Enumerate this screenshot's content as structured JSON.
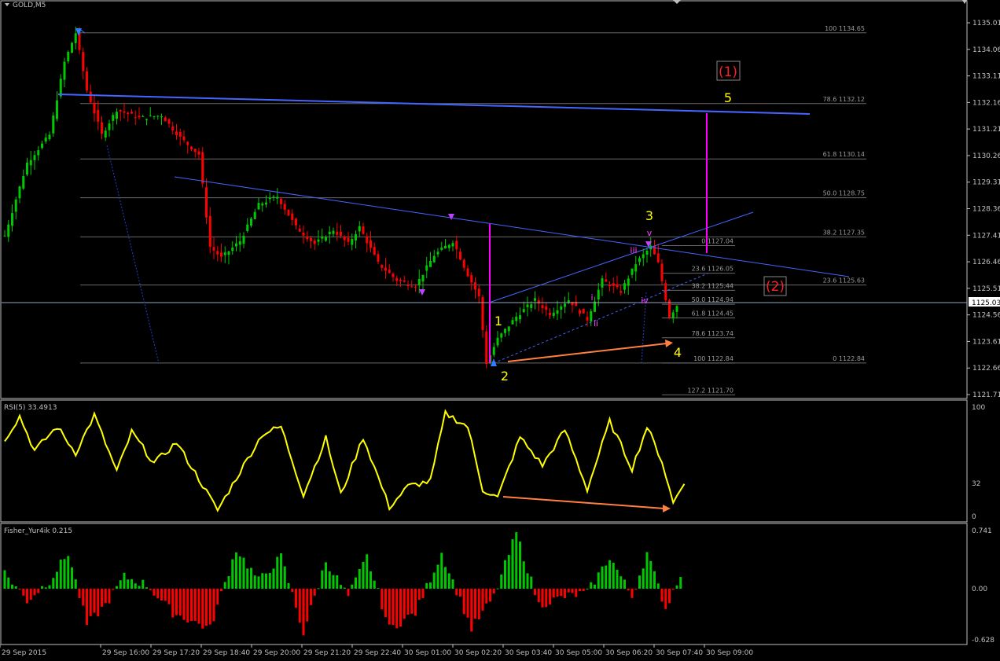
{
  "symbol": "GOLD,M5",
  "colors": {
    "background": "#000000",
    "frame": "#c0c0c0",
    "grid_text": "#c0c0c0",
    "bull": "#00c800",
    "bear": "#ff0000",
    "trend": "#4060ff",
    "fib": "#808080",
    "rsi": "#ffff00",
    "wave_yellow": "#ffff00",
    "wave_magenta": "#ff00ff",
    "wave_red": "#ff0000",
    "arrow_orange": "#ff8040",
    "marker_blue": "#2f7fff"
  },
  "price_axis": {
    "ticks": [
      "1135.01",
      "1134.06",
      "1133.11",
      "1132.16",
      "1131.21",
      "1130.26",
      "1129.31",
      "1128.36",
      "1127.41",
      "1126.46",
      "1125.51",
      "1124.56",
      "1123.61",
      "1122.66",
      "1121.71"
    ],
    "current": "1125.03"
  },
  "fib_levels": [
    {
      "label": "100 1134.65",
      "price": 1134.65
    },
    {
      "label": "78.6 1132.12",
      "price": 1132.12
    },
    {
      "label": "61.8 1130.14",
      "price": 1130.14
    },
    {
      "label": "50.0 1128.75",
      "price": 1128.75
    },
    {
      "label": "38.2 1127.35",
      "price": 1127.35
    },
    {
      "label": "23.6 1125.63",
      "price": 1125.63
    },
    {
      "label": "0 1122.84",
      "price": 1122.84
    }
  ],
  "fib2_levels": [
    {
      "label": "0 1127.04",
      "price": 1127.04
    },
    {
      "label": "23.6 1126.05",
      "price": 1126.05
    },
    {
      "label": "38.2 1125.44",
      "price": 1125.44
    },
    {
      "label": "50.0 1124.94",
      "price": 1124.94
    },
    {
      "label": "61.8 1124.45",
      "price": 1124.45
    },
    {
      "label": "78.6 1123.74",
      "price": 1123.74
    },
    {
      "label": "100 1122.84",
      "price": 1122.84
    },
    {
      "label": "127.2 1121.70",
      "price": 1121.7
    }
  ],
  "wave_labels": {
    "big1": "(1)",
    "big2": "(2)",
    "w1": "1",
    "w2": "2",
    "w3": "3",
    "w4": "4",
    "w5": "5",
    "si": "i",
    "sii": "ii",
    "siii": "iii",
    "siv": "iv",
    "sv": "v"
  },
  "rsi": {
    "label": "RSI(5) 33.4913",
    "scale": [
      "100",
      "32",
      "0"
    ]
  },
  "fisher": {
    "label": "Fisher_Yur4ik 0.215",
    "scale": [
      "0.741",
      "0.00",
      "-0.628"
    ]
  },
  "time_labels": [
    "29 Sep 2015",
    "29 Sep 16:00",
    "29 Sep 17:20",
    "29 Sep 18:40",
    "29 Sep 20:00",
    "29 Sep 21:20",
    "29 Sep 22:40",
    "30 Sep 01:00",
    "30 Sep 02:20",
    "30 Sep 03:40",
    "30 Sep 05:00",
    "30 Sep 06:20",
    "30 Sep 07:40",
    "30 Sep 09:00"
  ],
  "chart_data": {
    "type": "line",
    "title": "GOLD,M5",
    "ylim": [
      1121.71,
      1135.01
    ],
    "price_path": [
      {
        "bar": 0,
        "price": 1127.4
      },
      {
        "bar": 6,
        "price": 1130.0
      },
      {
        "bar": 12,
        "price": 1131.0
      },
      {
        "bar": 16,
        "price": 1133.6
      },
      {
        "bar": 19,
        "price": 1134.65
      },
      {
        "bar": 22,
        "price": 1132.6
      },
      {
        "bar": 26,
        "price": 1131.0
      },
      {
        "bar": 30,
        "price": 1131.9
      },
      {
        "bar": 36,
        "price": 1131.6
      },
      {
        "bar": 42,
        "price": 1131.7
      },
      {
        "bar": 47,
        "price": 1130.9
      },
      {
        "bar": 52,
        "price": 1130.3
      },
      {
        "bar": 55,
        "price": 1127.0
      },
      {
        "bar": 58,
        "price": 1126.6
      },
      {
        "bar": 63,
        "price": 1127.2
      },
      {
        "bar": 68,
        "price": 1128.5
      },
      {
        "bar": 73,
        "price": 1128.8
      },
      {
        "bar": 78,
        "price": 1127.7
      },
      {
        "bar": 83,
        "price": 1127.1
      },
      {
        "bar": 88,
        "price": 1127.6
      },
      {
        "bar": 92,
        "price": 1127.1
      },
      {
        "bar": 95,
        "price": 1127.7
      },
      {
        "bar": 100,
        "price": 1126.4
      },
      {
        "bar": 105,
        "price": 1125.8
      },
      {
        "bar": 110,
        "price": 1125.6
      },
      {
        "bar": 115,
        "price": 1126.7
      },
      {
        "bar": 120,
        "price": 1127.2
      },
      {
        "bar": 124,
        "price": 1126.0
      },
      {
        "bar": 127,
        "price": 1125.2
      },
      {
        "bar": 129,
        "price": 1122.84
      },
      {
        "bar": 132,
        "price": 1123.7
      },
      {
        "bar": 137,
        "price": 1124.5
      },
      {
        "bar": 142,
        "price": 1125.1
      },
      {
        "bar": 146,
        "price": 1124.6
      },
      {
        "bar": 151,
        "price": 1125.1
      },
      {
        "bar": 156,
        "price": 1124.4
      },
      {
        "bar": 160,
        "price": 1125.8
      },
      {
        "bar": 165,
        "price": 1125.4
      },
      {
        "bar": 169,
        "price": 1126.4
      },
      {
        "bar": 173,
        "price": 1127.0
      },
      {
        "bar": 175,
        "price": 1126.4
      },
      {
        "bar": 178,
        "price": 1124.5
      },
      {
        "bar": 180,
        "price": 1124.9
      }
    ],
    "rsi_path": [
      {
        "bar": 0,
        "value": 73
      },
      {
        "bar": 4,
        "value": 95
      },
      {
        "bar": 8,
        "value": 62
      },
      {
        "bar": 14,
        "value": 85
      },
      {
        "bar": 19,
        "value": 60
      },
      {
        "bar": 24,
        "value": 96
      },
      {
        "bar": 30,
        "value": 42
      },
      {
        "bar": 34,
        "value": 80
      },
      {
        "bar": 40,
        "value": 50
      },
      {
        "bar": 46,
        "value": 70
      },
      {
        "bar": 52,
        "value": 35
      },
      {
        "bar": 57,
        "value": 5
      },
      {
        "bar": 63,
        "value": 42
      },
      {
        "bar": 69,
        "value": 78
      },
      {
        "bar": 74,
        "value": 85
      },
      {
        "bar": 80,
        "value": 20
      },
      {
        "bar": 86,
        "value": 74
      },
      {
        "bar": 90,
        "value": 20
      },
      {
        "bar": 96,
        "value": 75
      },
      {
        "bar": 103,
        "value": 8
      },
      {
        "bar": 108,
        "value": 28
      },
      {
        "bar": 114,
        "value": 33
      },
      {
        "bar": 118,
        "value": 98
      },
      {
        "bar": 124,
        "value": 85
      },
      {
        "bar": 128,
        "value": 25
      },
      {
        "bar": 132,
        "value": 17
      },
      {
        "bar": 138,
        "value": 75
      },
      {
        "bar": 144,
        "value": 48
      },
      {
        "bar": 150,
        "value": 82
      },
      {
        "bar": 156,
        "value": 25
      },
      {
        "bar": 162,
        "value": 90
      },
      {
        "bar": 168,
        "value": 45
      },
      {
        "bar": 172,
        "value": 85
      },
      {
        "bar": 176,
        "value": 52
      },
      {
        "bar": 179,
        "value": 12
      },
      {
        "bar": 182,
        "value": 33
      }
    ],
    "fisher_path": [
      {
        "bar": 0,
        "value": 0.2
      },
      {
        "bar": 6,
        "value": -0.15
      },
      {
        "bar": 12,
        "value": 0.1
      },
      {
        "bar": 17,
        "value": 0.45
      },
      {
        "bar": 22,
        "value": -0.45
      },
      {
        "bar": 27,
        "value": -0.2
      },
      {
        "bar": 32,
        "value": 0.15
      },
      {
        "bar": 38,
        "value": 0.05
      },
      {
        "bar": 45,
        "value": -0.3
      },
      {
        "bar": 55,
        "value": -0.5
      },
      {
        "bar": 62,
        "value": 0.5
      },
      {
        "bar": 68,
        "value": 0.1
      },
      {
        "bar": 74,
        "value": 0.4
      },
      {
        "bar": 80,
        "value": -0.55
      },
      {
        "bar": 86,
        "value": 0.35
      },
      {
        "bar": 92,
        "value": -0.1
      },
      {
        "bar": 97,
        "value": 0.4
      },
      {
        "bar": 103,
        "value": -0.5
      },
      {
        "bar": 110,
        "value": -0.3
      },
      {
        "bar": 117,
        "value": 0.45
      },
      {
        "bar": 125,
        "value": -0.5
      },
      {
        "bar": 131,
        "value": -0.1
      },
      {
        "bar": 137,
        "value": 0.7
      },
      {
        "bar": 143,
        "value": -0.2
      },
      {
        "bar": 150,
        "value": -0.1
      },
      {
        "bar": 156,
        "value": -0.05
      },
      {
        "bar": 162,
        "value": 0.4
      },
      {
        "bar": 168,
        "value": -0.1
      },
      {
        "bar": 172,
        "value": 0.45
      },
      {
        "bar": 177,
        "value": -0.25
      },
      {
        "bar": 181,
        "value": 0.2
      }
    ]
  }
}
